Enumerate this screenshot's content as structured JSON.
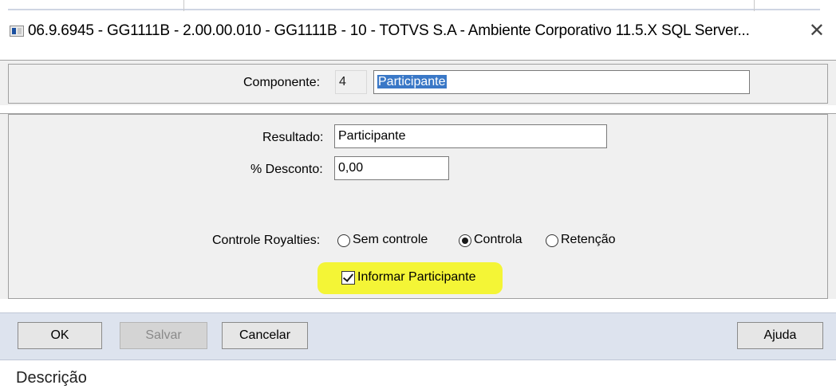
{
  "window": {
    "title": "06.9.6945 - GG1111B - 2.00.00.010 - GG1111B - 10 - TOTVS S.A - Ambiente Corporativo 11.5.X SQL Server...",
    "close_symbol": "✕"
  },
  "componente": {
    "label": "Componente:",
    "code": "4",
    "name": "Participante"
  },
  "resultado": {
    "label": "Resultado:",
    "value": "Participante"
  },
  "desconto": {
    "label": "% Desconto:",
    "value": "0,00"
  },
  "royalties": {
    "label": "Controle Royalties:",
    "options": [
      "Sem controle",
      "Controla",
      "Retenção"
    ],
    "selected": "Controla"
  },
  "informar": {
    "label": "Informar Participante",
    "checked": true,
    "highlight_color": "#f4f536"
  },
  "buttons": {
    "ok": "OK",
    "salvar": "Salvar",
    "cancelar": "Cancelar",
    "ajuda": "Ajuda"
  },
  "footer": {
    "label": "Descrição"
  }
}
